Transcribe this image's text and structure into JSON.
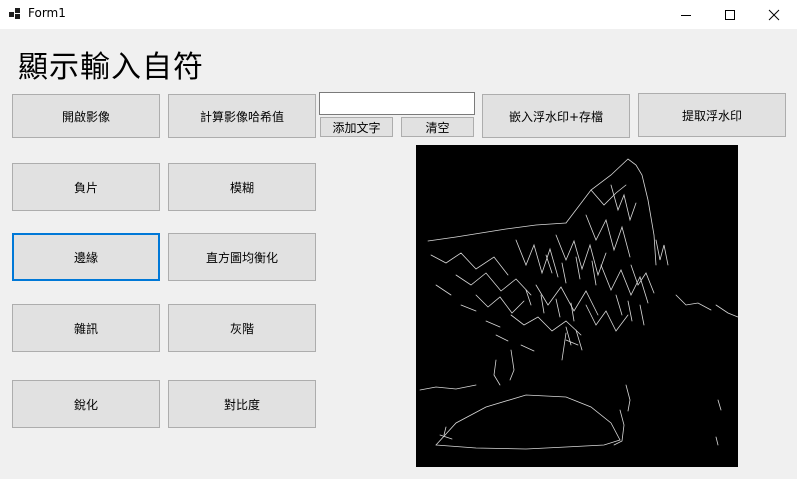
{
  "window": {
    "title": "Form1",
    "minimize_icon": "minimize-icon",
    "maximize_icon": "maximize-icon",
    "close_icon": "close-icon"
  },
  "heading": "顯示輸入自符",
  "buttons": {
    "open_image": "開啟影像",
    "compute_hash": "計算影像哈希值",
    "add_text": "添加文字",
    "clear": "清空",
    "embed_watermark_save": "嵌入浮水印+存檔",
    "extract_watermark": "提取浮水印",
    "negative": "負片",
    "blur": "模糊",
    "edge": "邊緣",
    "histogram_equalization": "直方圖均衡化",
    "noise": "雜訊",
    "grayscale": "灰階",
    "sharpen": "銳化",
    "contrast": "對比度"
  },
  "text_input": {
    "value": ""
  },
  "picture": {
    "description_icon": "edge-detected-image"
  },
  "colors": {
    "form_background": "#f0f0f0",
    "button_background": "#e1e1e1",
    "focus_border": "#0078d7",
    "image_background": "#000000",
    "edge_lines": "#d9d9d9"
  }
}
